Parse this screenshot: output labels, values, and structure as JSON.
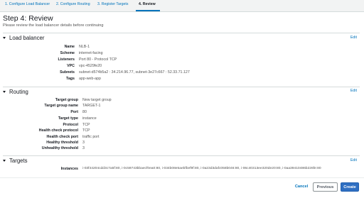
{
  "steps": [
    {
      "label": "1. Configure Load Balancer"
    },
    {
      "label": "2. Configure Routing"
    },
    {
      "label": "3. Register Targets"
    },
    {
      "label": "4. Review"
    }
  ],
  "page": {
    "title": "Step 4: Review",
    "subtitle": "Please review the load balancer details before continuing"
  },
  "edit_label": "Edit",
  "load_balancer": {
    "title": "Load balancer",
    "rows": [
      {
        "label": "Name",
        "value": "NLB-1"
      },
      {
        "label": "Scheme",
        "value": "internet-facing"
      },
      {
        "label": "Listeners",
        "value": "Port 80 - Protocol TCP"
      },
      {
        "label": "VPC",
        "value": "vpc-4529fe20"
      },
      {
        "label": "Subnets",
        "value": "subnet-d574b5a2 : 34.214.96.77, subnet-3e27c667 : 52.33.71.127"
      },
      {
        "label": "Tags",
        "value": "app-web-app"
      }
    ]
  },
  "routing": {
    "title": "Routing",
    "rows": [
      {
        "label": "Target group",
        "value": "New target group"
      },
      {
        "label": "Target group name",
        "value": "TARGET-1"
      },
      {
        "label": "Port",
        "value": "80"
      },
      {
        "label": "Target type",
        "value": "instance"
      },
      {
        "label": "Protocol",
        "value": "TCP"
      },
      {
        "label": "Health check protocol",
        "value": "TCP"
      },
      {
        "label": "Health check port",
        "value": "traffic port"
      },
      {
        "label": "Healthy threshold",
        "value": "3"
      },
      {
        "label": "Unhealthy threshold",
        "value": "3"
      }
    ]
  },
  "targets": {
    "title": "Targets",
    "rows": [
      {
        "label": "Instances",
        "value": "i-03f44204cdd3c7a5f:80, i-0c59743bbaecf0ea0:80, i-034b08e5aebfbef9f:80, i-0a23d3dafc058b046:80, i-06c40313ee320de20:80, i-0aa39410486b226fe:80"
      }
    ]
  },
  "buttons": {
    "cancel": "Cancel",
    "previous": "Previous",
    "create": "Create"
  }
}
